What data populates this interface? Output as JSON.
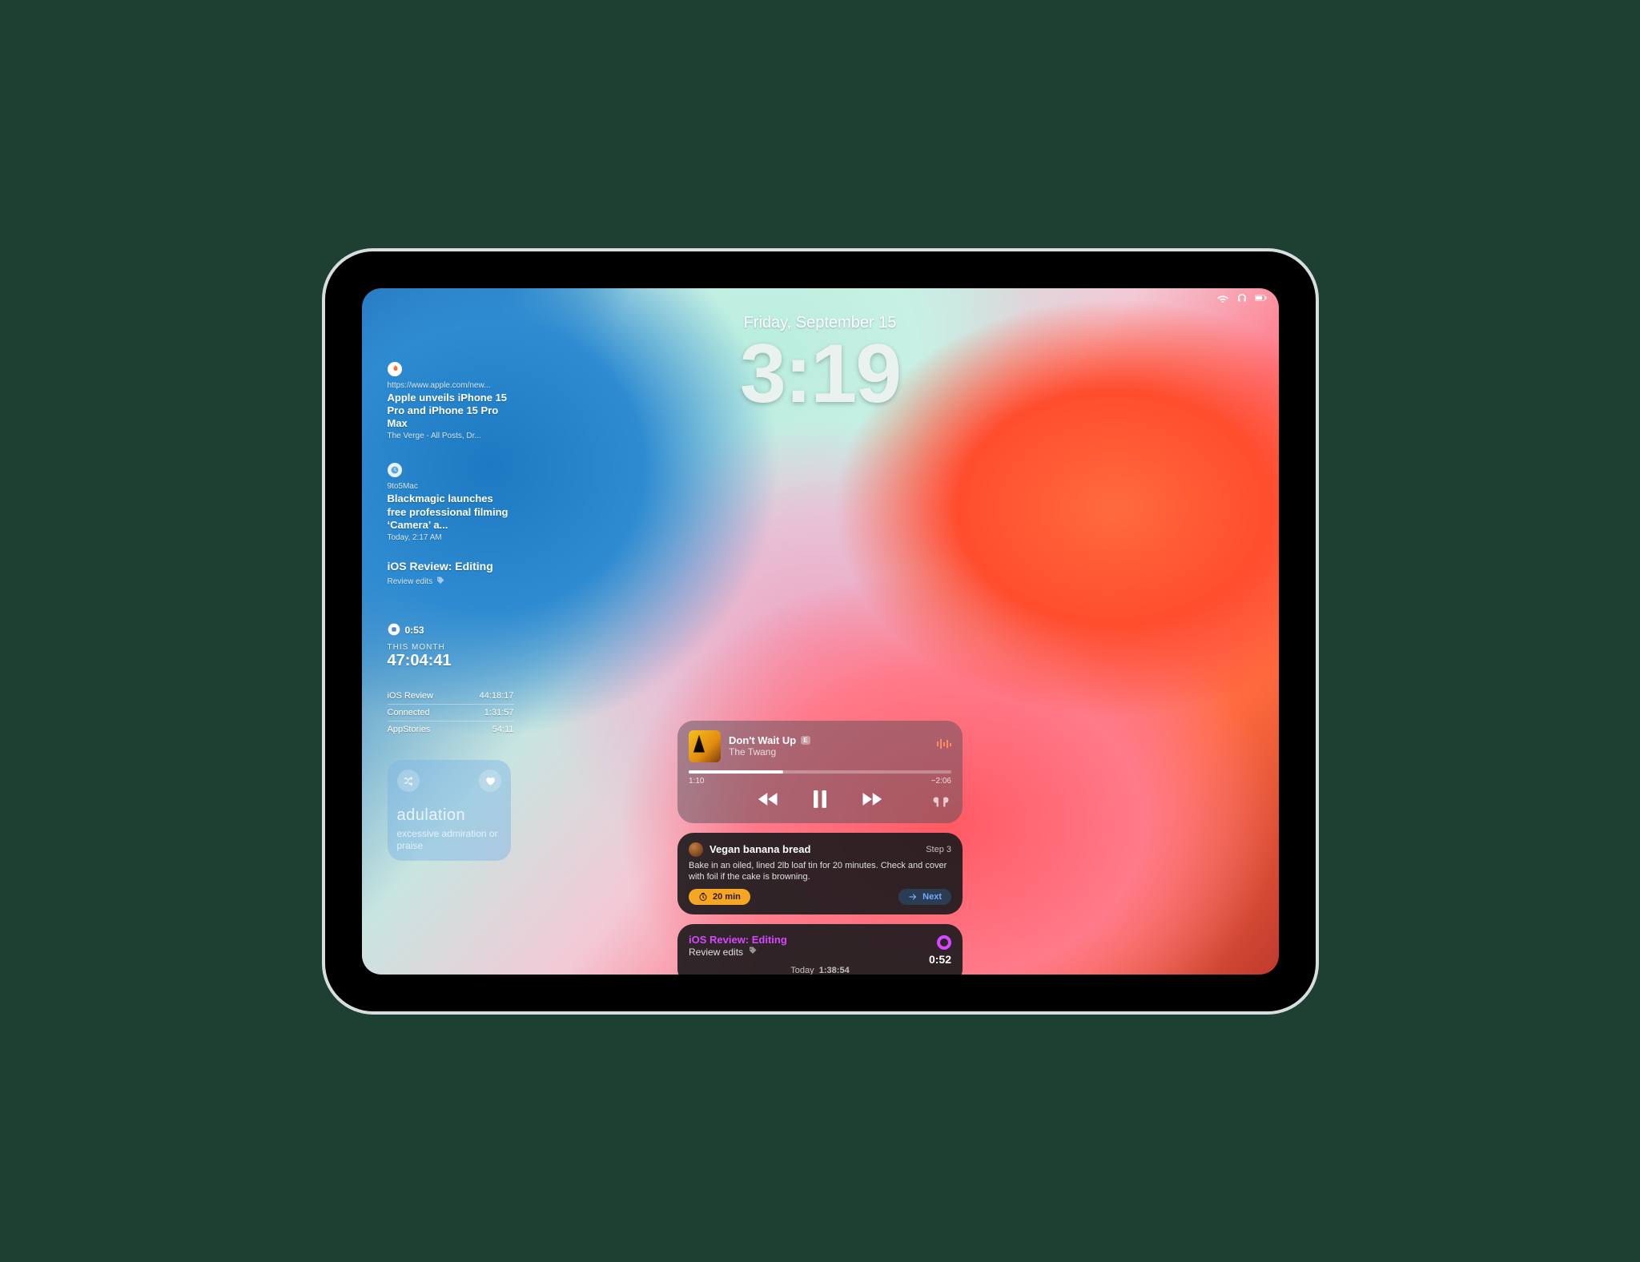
{
  "status": {
    "wifi": true,
    "headphones": true,
    "battery": true
  },
  "datetime": {
    "date": "Friday, September 15",
    "time": "3:19"
  },
  "left": {
    "news1": {
      "url": "https://www.apple.com/new...",
      "title": "Apple unveils iPhone 15 Pro and iPhone 15 Pro Max",
      "source": "The Verge -  All Posts, Dr..."
    },
    "news2": {
      "source": "9to5Mac",
      "title": "Blackmagic launches free professional filming ‘Camera’ a...",
      "time": "Today, 2:17 AM"
    },
    "task": {
      "title": "iOS Review: Editing",
      "sub": "Review edits"
    },
    "timer_small": {
      "current": "0:53",
      "label": "THIS MONTH",
      "total": "47:04:41"
    },
    "table": [
      {
        "name": "iOS Review",
        "time": "44:18:17"
      },
      {
        "name": "Connected",
        "time": "1:31:57"
      },
      {
        "name": "AppStories",
        "time": "54:11"
      }
    ],
    "word": {
      "word": "adulation",
      "definition": "excessive admiration or praise"
    }
  },
  "music": {
    "title": "Don't Wait Up",
    "explicit": "E",
    "artist": "The Twang",
    "elapsed": "1:10",
    "remaining": "−2:06",
    "progress_pct": 36
  },
  "recipe": {
    "name": "Vegan banana bread",
    "step_label": "Step 3",
    "text": "Bake in an oiled, lined 2lb loaf tin for 20 minutes. Check and cover with foil if the cake is browning.",
    "timer": "20 min",
    "next": "Next"
  },
  "timery": {
    "title": "iOS Review: Editing",
    "sub": "Review edits",
    "elapsed": "0:52",
    "footer_prefix": "Today",
    "footer_time": "1:38:54"
  }
}
